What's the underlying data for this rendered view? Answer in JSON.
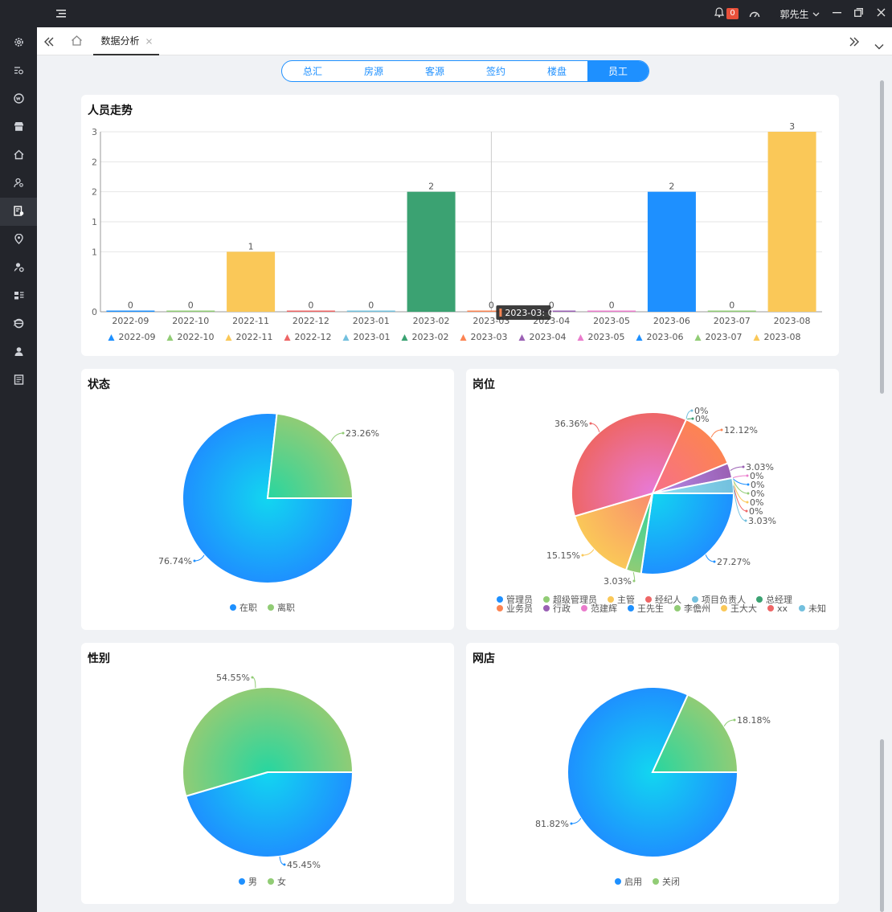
{
  "titlebar": {
    "notification_count": "0",
    "user_name": "郭先生"
  },
  "tabbar": {
    "active_tab": "数据分析"
  },
  "segments": [
    {
      "label": "总汇",
      "active": false
    },
    {
      "label": "房源",
      "active": false
    },
    {
      "label": "客源",
      "active": false
    },
    {
      "label": "签约",
      "active": false
    },
    {
      "label": "楼盘",
      "active": false
    },
    {
      "label": "员工",
      "active": true
    }
  ],
  "cards": {
    "trend_title": "人员走势",
    "status_title": "状态",
    "position_title": "岗位",
    "gender_title": "性别",
    "shop_title": "网店"
  },
  "chart_data": [
    {
      "type": "bar",
      "title": "人员走势",
      "categories": [
        "2022-09",
        "2022-10",
        "2022-11",
        "2022-12",
        "2023-01",
        "2023-02",
        "2023-03",
        "2023-04",
        "2023-05",
        "2023-06",
        "2023-07",
        "2023-08"
      ],
      "values": [
        0,
        0,
        1,
        0,
        0,
        2,
        0,
        0,
        0,
        2,
        0,
        3
      ],
      "axis_values": [
        0,
        1,
        1.5,
        2,
        2.5,
        3
      ],
      "yticks": [
        "0",
        "1",
        "1",
        "2",
        "2",
        "3"
      ],
      "ylim": [
        0,
        3
      ],
      "colors": [
        "#1e90ff",
        "#91cc75",
        "#fac858",
        "#ee6666",
        "#73c0de",
        "#3ba272",
        "#fc8452",
        "#9a60b4",
        "#ea7ccc",
        "#1e90ff",
        "#91cc75",
        "#fac858"
      ],
      "grid": true,
      "legend": "bottom",
      "tooltip": {
        "label": "2023-03: 0"
      }
    },
    {
      "type": "pie",
      "title": "状态",
      "slices": [
        {
          "name": "在职",
          "value": 76.74,
          "label": "76.74%",
          "color": "#1e90ff"
        },
        {
          "name": "离职",
          "value": 23.26,
          "label": "23.26%",
          "color": "#91cc75"
        }
      ],
      "legend": "bottom"
    },
    {
      "type": "pie",
      "title": "岗位",
      "slices": [
        {
          "name": "王先生",
          "value": 27.27,
          "label": "27.27%",
          "color": "#1e90ff"
        },
        {
          "name": "李儋州",
          "value": 3.03,
          "label": "3.03%",
          "color": "#91cc75"
        },
        {
          "name": "主管",
          "value": 15.15,
          "label": "15.15%",
          "color": "#fac858"
        },
        {
          "name": "经纪人",
          "value": 36.36,
          "label": "36.36%",
          "color": "#ee6666"
        },
        {
          "name": "项目负责人",
          "value": 0,
          "label": "0%",
          "color": "#73c0de"
        },
        {
          "name": "总经理",
          "value": 0,
          "label": "0%",
          "color": "#3ba272"
        },
        {
          "name": "业务员",
          "value": 12.12,
          "label": "12.12%",
          "color": "#fc8452"
        },
        {
          "name": "行政",
          "value": 3.03,
          "label": "3.03%",
          "color": "#9a60b4"
        },
        {
          "name": "范建辉",
          "value": 0,
          "label": "0%",
          "color": "#ea7ccc"
        },
        {
          "name": "管理员",
          "value": 0,
          "label": "0%",
          "color": "#1e90ff"
        },
        {
          "name": "超级管理员",
          "value": 0,
          "label": "0%",
          "color": "#91cc75"
        },
        {
          "name": "王大大",
          "value": 0,
          "label": "0%",
          "color": "#fac858"
        },
        {
          "name": "xx",
          "value": 0,
          "label": "0%",
          "color": "#ee6666"
        },
        {
          "name": "未知",
          "value": 3.03,
          "label": "3.03%",
          "color": "#73c0de"
        }
      ],
      "legend_row1": [
        "管理员",
        "超级管理员",
        "主管",
        "经纪人",
        "项目负责人",
        "总经理"
      ],
      "legend_row2": [
        "业务员",
        "行政",
        "范建辉",
        "王先生",
        "李儋州",
        "王大大",
        "xx",
        "未知"
      ],
      "legend": "bottom"
    },
    {
      "type": "pie",
      "title": "性别",
      "slices": [
        {
          "name": "男",
          "value": 45.45,
          "label": "45.45%",
          "color": "#1e90ff"
        },
        {
          "name": "女",
          "value": 54.55,
          "label": "54.55%",
          "color": "#91cc75"
        }
      ],
      "legend": "bottom"
    },
    {
      "type": "pie",
      "title": "网店",
      "slices": [
        {
          "name": "启用",
          "value": 81.82,
          "label": "81.82%",
          "color": "#1e90ff"
        },
        {
          "name": "关闭",
          "value": 18.18,
          "label": "18.18%",
          "color": "#91cc75"
        }
      ],
      "legend": "bottom"
    }
  ]
}
